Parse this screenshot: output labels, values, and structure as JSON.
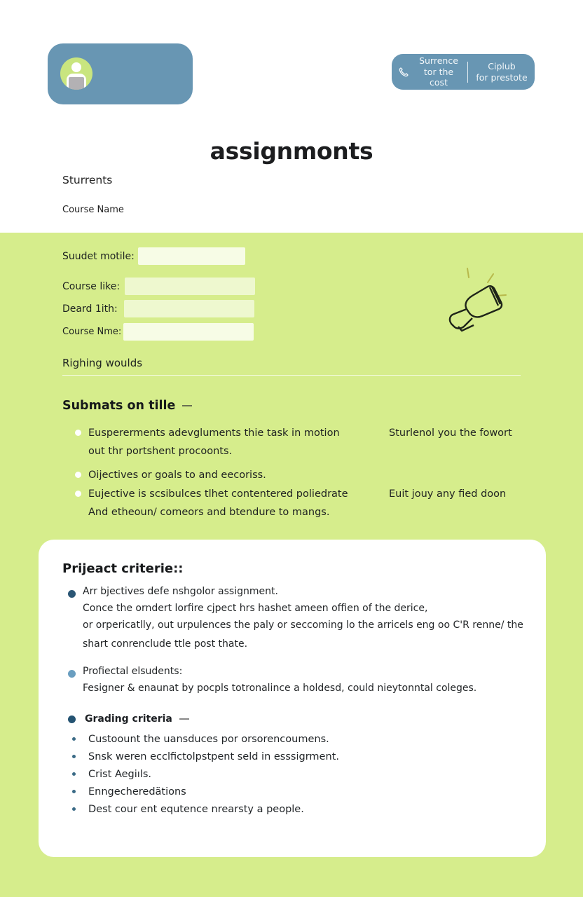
{
  "header": {
    "profile_card": {
      "avatar_icon": "user-avatar-icon"
    },
    "contact_pill": {
      "icon": "phone-icon",
      "left_label_line1": "Surrence",
      "left_label_line2": "tor the cost",
      "right_label_line1": "Ciplub",
      "right_label_line2": "for prestote"
    },
    "title": "assignmonts",
    "subtitle": "Sturrents",
    "course_name": "Course Name"
  },
  "form": {
    "fields": [
      {
        "label": "Suudet motile:",
        "value": ""
      },
      {
        "label": "Course like:",
        "value": ""
      },
      {
        "label": "Deard 1ith:",
        "value": ""
      },
      {
        "label": "Course Nme:",
        "value": ""
      }
    ],
    "section_label": "Righing woulds",
    "decor_icon": "megaphone-icon"
  },
  "submissions": {
    "title": "Submats on tille",
    "items": [
      {
        "lines": [
          "Euspererments adevgluments thie task in motion",
          "out thr portshent procoonts."
        ],
        "side": "Sturlenol you the fowort"
      },
      {
        "lines": [
          "Oijectives or goals to and eecoriss."
        ],
        "side": ""
      },
      {
        "lines": [
          "Eujective is scsibulces tlhet contentered poliedrate",
          "And etheoun/ comeors and btendure to mangs."
        ],
        "side": "Euit jouy any fied doon"
      }
    ]
  },
  "project_criteria": {
    "title": "Prijeact criterie::",
    "blocks": [
      {
        "bullet_color": "#2b5675",
        "lines": [
          "Arr bjectives defe nsһgolor assignment.",
          "Conce the orndert lorfire cjpect hrs hashet ameen offien of the derice,",
          "or orpericatlly, out urpulences the paly or seccoming lo the arricels eng oo C'R renne/ the",
          "shart conrenclude ttle post thate."
        ]
      },
      {
        "bullet_color": "#6a9ec0",
        "lines": [
          "Profiectal elsudents:",
          "Fesigner & enaunat by pocpls totronalince a holdesd, could nieytonntal coleges."
        ]
      }
    ],
    "grading": {
      "title": "Grading criteria",
      "items": [
        "Custoount the uansduces por orsorencoumens.",
        "Snsk weren ecclfictolpstpent seld in esssigrment.",
        "Crist Aegiıls.",
        "Enngecheredätions",
        "Dest cour ent equtence nrearsty a people."
      ]
    }
  },
  "colors": {
    "accent_blue": "#6896b3",
    "lime_background": "#d6ed8c",
    "avatar_green": "#c9e57f",
    "dark_bullet": "#245372"
  }
}
